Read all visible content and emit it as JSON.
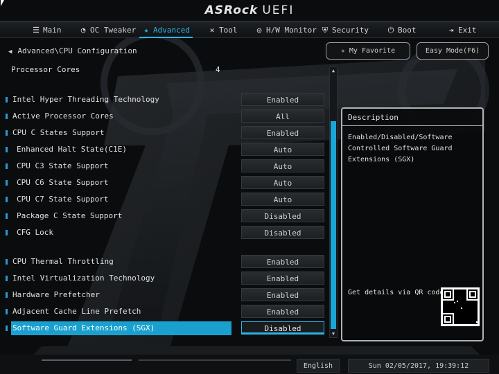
{
  "brand": {
    "name": "ASRock",
    "suffix": "UEFI"
  },
  "nav": [
    {
      "id": "main",
      "label": "Main",
      "icon": "list-icon"
    },
    {
      "id": "oc",
      "label": "OC Tweaker",
      "icon": "gauge-icon"
    },
    {
      "id": "advanced",
      "label": "Advanced",
      "icon": "star-icon",
      "active": true
    },
    {
      "id": "tool",
      "label": "Tool",
      "icon": "wrench-icon"
    },
    {
      "id": "hw",
      "label": "H/W Monitor",
      "icon": "monitor-icon"
    },
    {
      "id": "security",
      "label": "Security",
      "icon": "shield-icon"
    },
    {
      "id": "boot",
      "label": "Boot",
      "icon": "power-icon"
    },
    {
      "id": "exit",
      "label": "Exit",
      "icon": "exit-icon"
    }
  ],
  "breadcrumb": "Advanced\\CPU Configuration",
  "buttons": {
    "favorite": "My Favorite",
    "easy_mode": "Easy Mode(F6)"
  },
  "processor_cores": {
    "label": "Processor Cores",
    "value": "4"
  },
  "settings": [
    {
      "label": "Intel Hyper Threading Technology",
      "value": "Enabled",
      "sub": false
    },
    {
      "label": "Active Processor Cores",
      "value": "All",
      "sub": false
    },
    {
      "label": "CPU C States Support",
      "value": "Enabled",
      "sub": false
    },
    {
      "label": "Enhanced Halt State(C1E)",
      "value": "Auto",
      "sub": true
    },
    {
      "label": "CPU C3 State Support",
      "value": "Auto",
      "sub": true
    },
    {
      "label": "CPU C6 State Support",
      "value": "Auto",
      "sub": true
    },
    {
      "label": "CPU C7 State Support",
      "value": "Auto",
      "sub": true
    },
    {
      "label": "Package C State Support",
      "value": "Disabled",
      "sub": true
    },
    {
      "label": "CFG Lock",
      "value": "Disabled",
      "sub": true
    },
    {
      "label": "CPU Thermal Throttling",
      "value": "Enabled",
      "sub": false
    },
    {
      "label": "Intel Virtualization Technology",
      "value": "Enabled",
      "sub": false
    },
    {
      "label": "Hardware Prefetcher",
      "value": "Enabled",
      "sub": false
    },
    {
      "label": "Adjacent Cache Line Prefetch",
      "value": "Enabled",
      "sub": false
    },
    {
      "label": "Software Guard Extensions (SGX)",
      "value": "Disabled",
      "sub": false,
      "selected": true
    }
  ],
  "description": {
    "title": "Description",
    "text": "Enabled/Disabled/Software Controlled Software Guard Extensions (SGX)",
    "qr_label": "Get details via QR code"
  },
  "footer": {
    "language": "English",
    "datetime": "Sun 02/05/2017, 19:39:12"
  },
  "colors": {
    "accent": "#1aa6d6",
    "background": "#0b0c0d"
  }
}
